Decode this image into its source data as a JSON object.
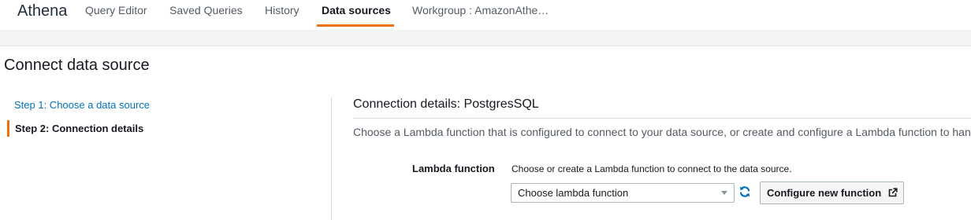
{
  "nav": {
    "brand": "Athena",
    "links": [
      "Query Editor",
      "Saved Queries",
      "History",
      "Data sources",
      "Workgroup : AmazonAthe…"
    ],
    "active_index": 3
  },
  "page": {
    "title": "Connect data source"
  },
  "steps": [
    {
      "label": "Step 1: Choose a data source"
    },
    {
      "label": "Step 2: Connection details"
    }
  ],
  "connection": {
    "title": "Connection details: PostgresSQL",
    "description": "Choose a Lambda function that is configured to connect to your data source, or create and configure a Lambda function to han",
    "lambda_label": "Lambda function",
    "lambda_hint": "Choose or create a Lambda function to connect to the data source.",
    "select_value": "Choose lambda function",
    "configure_button": "Configure new function"
  },
  "colors": {
    "accent": "#ec7211",
    "link": "#0073bb",
    "refresh_icon": "#0073bb"
  },
  "icons": {
    "refresh": "refresh-icon",
    "external_link": "external-link-icon",
    "dropdown": "caret-down-icon"
  }
}
